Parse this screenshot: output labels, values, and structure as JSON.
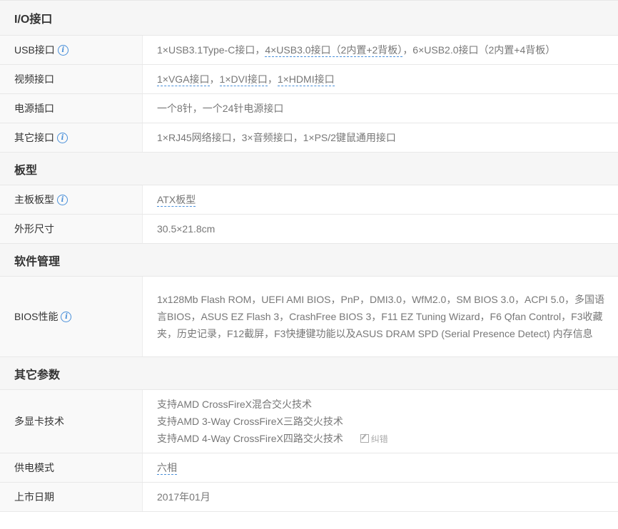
{
  "sections": [
    {
      "title": "I/O接口",
      "rows": [
        {
          "label": "USB接口",
          "parts": [
            "1×USB3.1Type-C接口，",
            "4×USB3.0接口（2内置+2背板）",
            "，6×USB2.0接口（2内置+4背板）"
          ]
        },
        {
          "label": "视频接口",
          "parts": [
            "1×VGA接口",
            "，",
            "1×DVI接口",
            "，",
            "1×HDMI接口"
          ]
        },
        {
          "label": "电源插口",
          "value": "一个8针，一个24针电源接口"
        },
        {
          "label": "其它接口",
          "value": "1×RJ45网络接口，3×音频接口，1×PS/2键鼠通用接口"
        }
      ]
    },
    {
      "title": "板型",
      "rows": [
        {
          "label": "主板板型",
          "value": "ATX板型"
        },
        {
          "label": "外形尺寸",
          "value": "30.5×21.8cm"
        }
      ]
    },
    {
      "title": "软件管理",
      "rows": [
        {
          "label": "BIOS性能",
          "value": "1x128Mb Flash ROM，UEFI AMI BIOS，PnP，DMI3.0，WfM2.0，SM BIOS 3.0，ACPI 5.0，多国语言BIOS，ASUS EZ Flash 3，CrashFree BIOS 3，F11 EZ Tuning Wizard，F6 Qfan Control，F3收藏夹，历史记录，F12截屏，F3快捷键功能以及ASUS DRAM SPD (Serial Presence Detect) 内存信息"
        }
      ]
    },
    {
      "title": "其它参数",
      "rows": [
        {
          "label": "多显卡技术",
          "lines": [
            "支持AMD CrossFireX混合交火技术",
            "支持AMD 3-Way CrossFireX三路交火技术",
            "支持AMD 4-Way CrossFireX四路交火技术"
          ],
          "edit_label": "纠错"
        },
        {
          "label": "供电模式",
          "value": "六相"
        },
        {
          "label": "上市日期",
          "value": "2017年01月"
        }
      ]
    }
  ],
  "info_icon": "i",
  "colors": {
    "accent": "#4a90d9",
    "section_bg": "#f6f6f6",
    "label_bg": "#f9f9f9",
    "border": "#e8e8e8"
  }
}
